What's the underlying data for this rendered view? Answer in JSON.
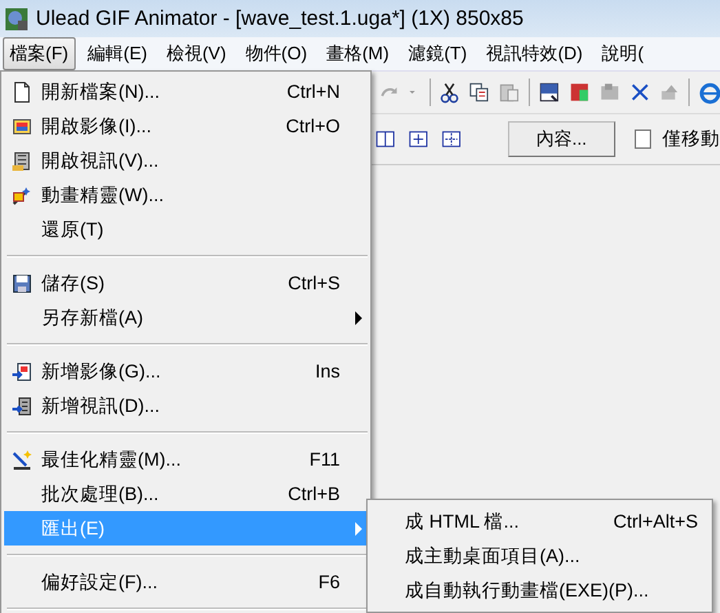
{
  "window": {
    "title": "Ulead GIF Animator - [wave_test.1.uga*] (1X) 850x85"
  },
  "menu_bar": [
    {
      "label": "檔案(F)",
      "selected": true
    },
    {
      "label": "編輯(E)",
      "selected": false
    },
    {
      "label": "檢視(V)",
      "selected": false
    },
    {
      "label": "物件(O)",
      "selected": false
    },
    {
      "label": "畫格(M)",
      "selected": false
    },
    {
      "label": "濾鏡(T)",
      "selected": false
    },
    {
      "label": "視訊特效(D)",
      "selected": false
    },
    {
      "label": "說明(",
      "selected": false
    }
  ],
  "toolbar": {
    "properties_button": "內容...",
    "checkbox": {
      "label": "僅移動",
      "checked": false
    }
  },
  "file_menu": [
    {
      "kind": "item",
      "label": "開新檔案(N)...",
      "shortcut": "Ctrl+N",
      "selected": false
    },
    {
      "kind": "item",
      "label": "開啟影像(I)...",
      "shortcut": "Ctrl+O",
      "selected": false
    },
    {
      "kind": "item",
      "label": "開啟視訊(V)...",
      "selected": false
    },
    {
      "kind": "item",
      "label": "動畫精靈(W)...",
      "selected": false
    },
    {
      "kind": "item",
      "label": "還原(T)",
      "selected": false
    },
    {
      "kind": "separator"
    },
    {
      "kind": "item",
      "label": "儲存(S)",
      "shortcut": "Ctrl+S",
      "selected": false
    },
    {
      "kind": "submenu",
      "label": "另存新檔(A)",
      "selected": false
    },
    {
      "kind": "separator"
    },
    {
      "kind": "item",
      "label": "新增影像(G)...",
      "shortcut": "Ins",
      "selected": false
    },
    {
      "kind": "item",
      "label": "新增視訊(D)...",
      "selected": false
    },
    {
      "kind": "separator"
    },
    {
      "kind": "item",
      "label": "最佳化精靈(M)...",
      "shortcut": "F11",
      "selected": false
    },
    {
      "kind": "item",
      "label": "批次處理(B)...",
      "shortcut": "Ctrl+B",
      "selected": false
    },
    {
      "kind": "submenu",
      "label": "匯出(E)",
      "selected": true
    },
    {
      "kind": "separator"
    },
    {
      "kind": "item",
      "label": "偏好設定(F)...",
      "shortcut": "F6",
      "selected": false
    },
    {
      "kind": "separator"
    }
  ],
  "export_submenu": [
    {
      "label": "成 HTML 檔...",
      "shortcut": "Ctrl+Alt+S"
    },
    {
      "label": "成主動桌面項目(A)..."
    },
    {
      "label": "成自動執行動畫檔(EXE)(P)..."
    }
  ]
}
